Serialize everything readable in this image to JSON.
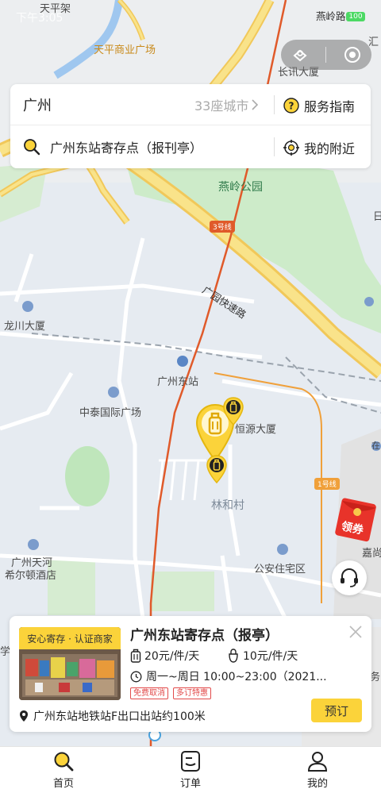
{
  "status_bar": {
    "time": "下午3:05",
    "battery": "100"
  },
  "map": {
    "labels": {
      "tianping_overpass": "天平架",
      "tianping_plaza": "天平商业广场",
      "yanling_rd": "燕岭路",
      "changxun": "长讯大厦",
      "hui": "汇",
      "yanling_park": "燕岭公园",
      "guangyuan_expwy": "广园快速路",
      "longchuan": "龙川大厦",
      "gz_east": "广州东站",
      "zhongtai": "中泰国际广场",
      "hengyuan": "恒源大厦",
      "linhe": "林和村",
      "hilton_1": "广州天河",
      "hilton_2": "希尔顿酒店",
      "gongan": "公安住宅区",
      "jiashang": "嘉尚",
      "xue": "学",
      "zai": "在",
      "wu": "务",
      "ri": "日"
    },
    "metro_tags": {
      "line3": "3号线",
      "line1": "1号线"
    }
  },
  "search": {
    "city": "广州",
    "city_count": "33座城市",
    "service_guide": "服务指南",
    "query": "广州东站寄存点（报刊亭）",
    "nearby": "我的附近"
  },
  "floating": {
    "red_packet_label": "领券"
  },
  "store": {
    "badge": "安心寄存 · 认证商家",
    "name": "广州东站寄存点（报亭）",
    "price_large": "20元/件/天",
    "price_small": "10元/件/天",
    "hours": "周一~周日 10:00~23:00（2021...",
    "tags": [
      "免费取消",
      "多订特惠"
    ],
    "address": "广州东站地铁站F出口出站约100米",
    "book_label": "预订"
  },
  "bottom_nav": {
    "items": [
      {
        "label": "首页",
        "icon": "search-icon",
        "active": true
      },
      {
        "label": "订单",
        "icon": "order-icon",
        "active": false
      },
      {
        "label": "我的",
        "icon": "user-icon",
        "active": false
      }
    ]
  },
  "colors": {
    "accent": "#fbd33a",
    "tag_red": "#e24b4b",
    "metro_line": "#e05a2a",
    "expressway": "#f5d56b"
  }
}
